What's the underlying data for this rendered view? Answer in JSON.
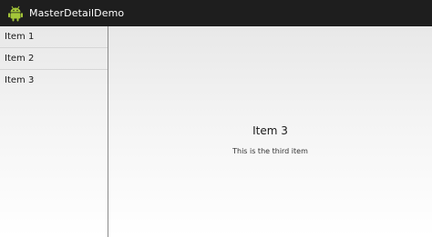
{
  "app": {
    "title": "MasterDetailDemo",
    "icon": "android-icon",
    "icon_color": "#a4c639"
  },
  "list": {
    "items": [
      {
        "label": "Item 1"
      },
      {
        "label": "Item 2"
      },
      {
        "label": "Item 3"
      }
    ]
  },
  "detail": {
    "title": "Item 3",
    "description": "This is the third item"
  }
}
